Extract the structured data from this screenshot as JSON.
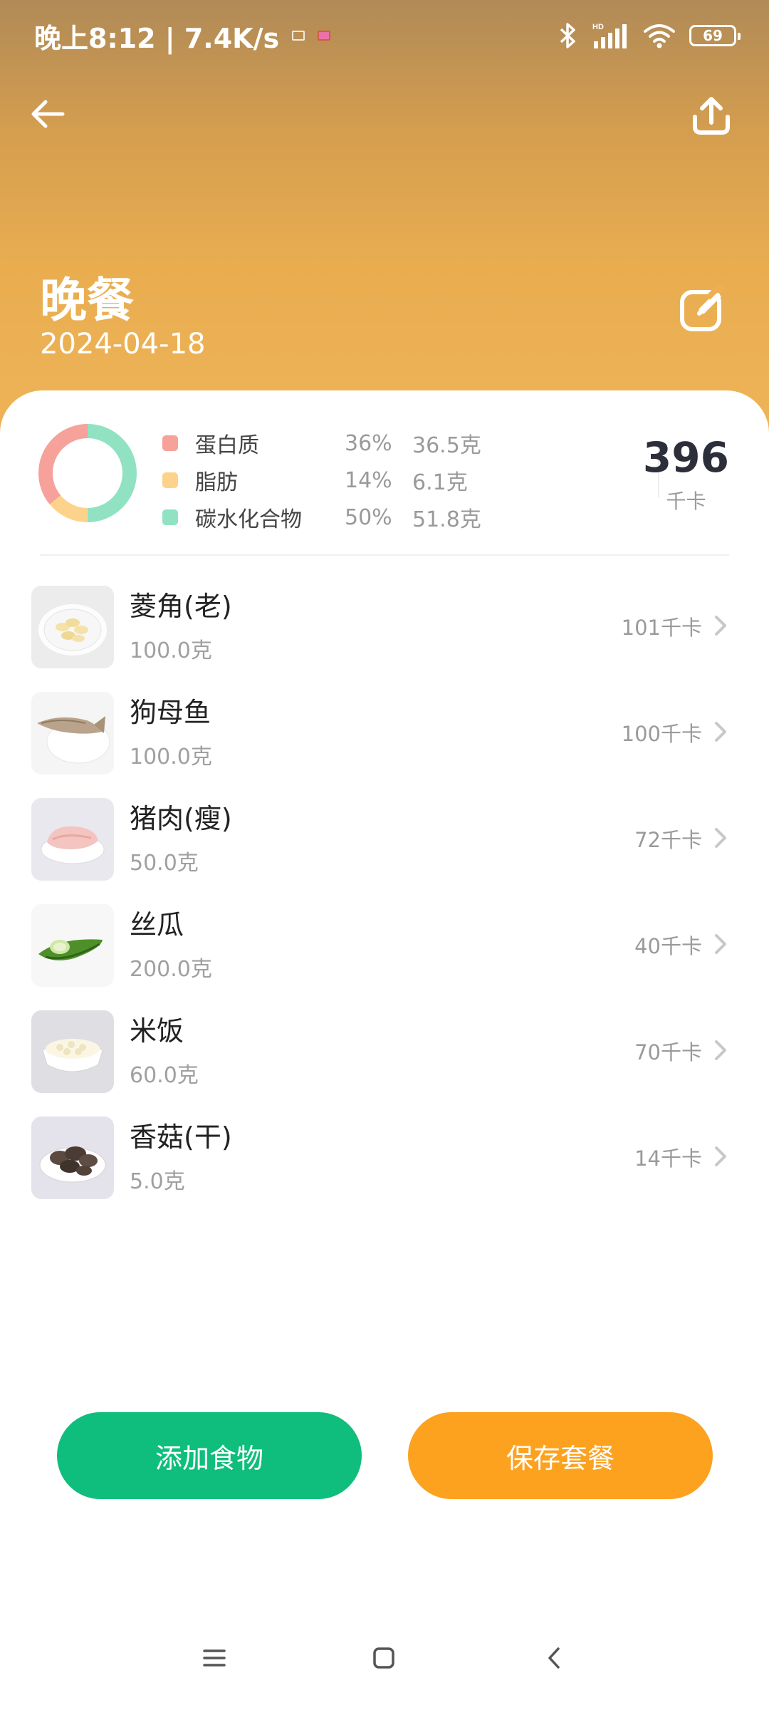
{
  "statusbar": {
    "time_speed": "晚上8:12 | 7.4K/s",
    "battery": "69",
    "icons": [
      "bluetooth-icon",
      "hd-signal-icon",
      "wifi-icon",
      "battery-icon"
    ]
  },
  "header": {
    "title": "晚餐",
    "date": "2024-04-18",
    "icons": [
      "back-arrow-icon",
      "share-upload-icon",
      "edit-icon"
    ]
  },
  "summary": {
    "nutrients": [
      {
        "name": "蛋白质",
        "percent": "36%",
        "grams": "36.5克",
        "color": "#f6a19a",
        "fraction": 0.36
      },
      {
        "name": "脂肪",
        "percent": "14%",
        "grams": "6.1克",
        "color": "#fdd38b",
        "fraction": 0.14
      },
      {
        "name": "碳水化合物",
        "percent": "50%",
        "grams": "51.8克",
        "color": "#90e2c3",
        "fraction": 0.5
      }
    ],
    "total_kcal": "396",
    "total_unit": "千卡"
  },
  "foods": [
    {
      "name": "菱角(老)",
      "weight": "100.0克",
      "kcal": "101千卡",
      "thumb": "water-caltrop-image"
    },
    {
      "name": "狗母鱼",
      "weight": "100.0克",
      "kcal": "100千卡",
      "thumb": "lizardfish-image"
    },
    {
      "name": "猪肉(瘦)",
      "weight": "50.0克",
      "kcal": "72千卡",
      "thumb": "lean-pork-image"
    },
    {
      "name": "丝瓜",
      "weight": "200.0克",
      "kcal": "40千卡",
      "thumb": "loofah-image"
    },
    {
      "name": "米饭",
      "weight": "60.0克",
      "kcal": "70千卡",
      "thumb": "rice-image"
    },
    {
      "name": "香菇(干)",
      "weight": "5.0克",
      "kcal": "14千卡",
      "thumb": "dried-shiitake-image"
    }
  ],
  "actions": {
    "add_label": "添加食物",
    "save_label": "保存套餐",
    "add_color": "#0fbe7c",
    "save_color": "#fca21f"
  },
  "navbar": {
    "icons": [
      "menu-icon",
      "home-icon",
      "back-icon"
    ]
  }
}
